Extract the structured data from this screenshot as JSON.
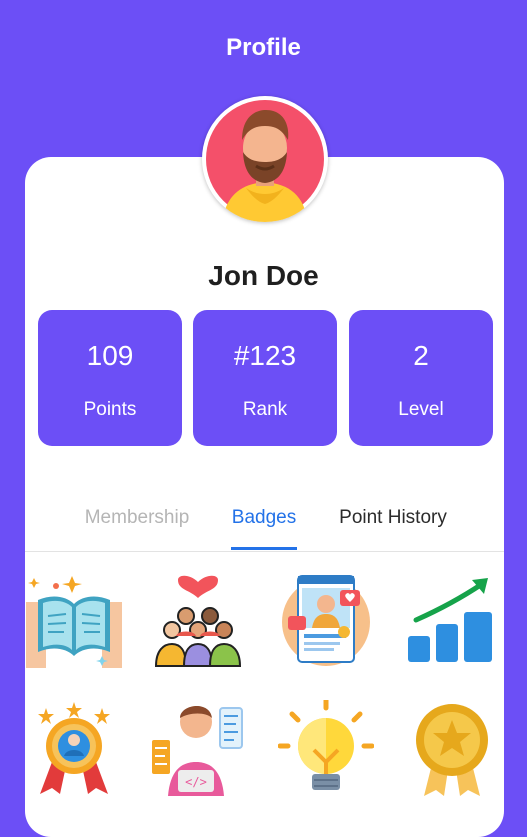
{
  "header": {
    "title": "Profile"
  },
  "profile": {
    "name": "Jon Doe",
    "avatar_icon": "man-with-beard-avatar-icon"
  },
  "stats": [
    {
      "value": "109",
      "label": "Points"
    },
    {
      "value": "#123",
      "label": "Rank"
    },
    {
      "value": "2",
      "label": "Level"
    }
  ],
  "tabs": [
    {
      "label": "Membership",
      "active": false
    },
    {
      "label": "Badges",
      "active": true
    },
    {
      "label": "Point History",
      "active": false
    }
  ],
  "badges": [
    {
      "icon": "open-book-icon"
    },
    {
      "icon": "community-heart-icon"
    },
    {
      "icon": "social-post-icon"
    },
    {
      "icon": "growth-chart-icon"
    },
    {
      "icon": "award-medal-icon"
    },
    {
      "icon": "developer-icon"
    },
    {
      "icon": "idea-bulb-icon"
    },
    {
      "icon": "star-rosette-icon"
    }
  ],
  "colors": {
    "brand": "#6C4FF6",
    "tab_active": "#2372e8",
    "tab_inactive": "#b5b5b5"
  }
}
